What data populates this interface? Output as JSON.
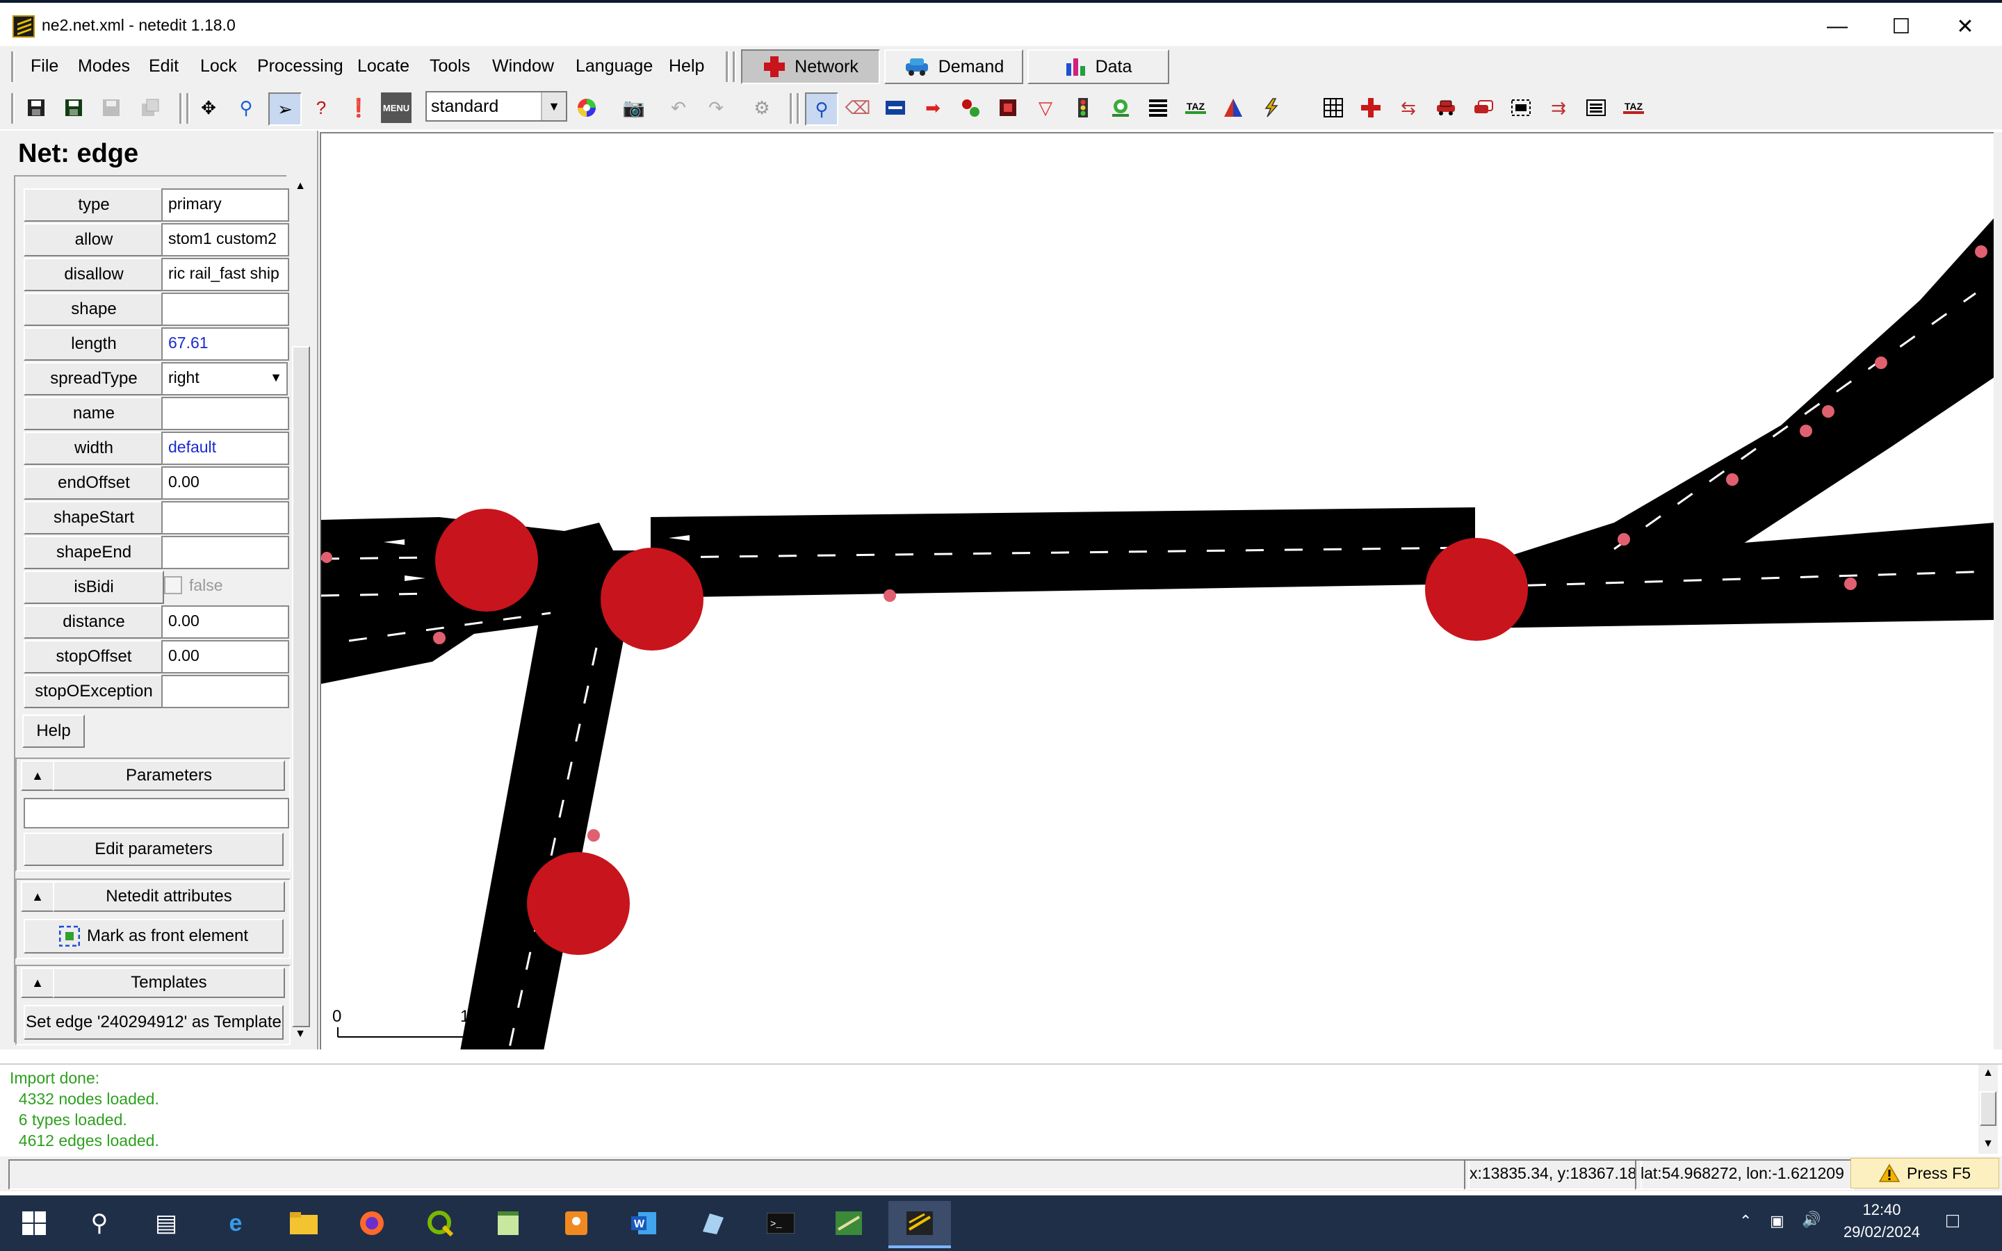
{
  "window": {
    "title": "ne2.net.xml - netedit 1.18.0"
  },
  "menu": {
    "items": [
      "File",
      "Modes",
      "Edit",
      "Lock",
      "Processing",
      "Locate",
      "Tools",
      "Window",
      "Language",
      "Help"
    ],
    "supermodes": [
      "Network",
      "Demand",
      "Data"
    ]
  },
  "toolbar": {
    "scheme": "standard",
    "taz_label_1": "TAZ",
    "taz_label_2": "TAZ",
    "menu_label": "MENU"
  },
  "sidebar": {
    "title": "Net: edge",
    "attributes": [
      {
        "name": "type",
        "value": "primary"
      },
      {
        "name": "allow",
        "value": "stom1 custom2"
      },
      {
        "name": "disallow",
        "value": "ric rail_fast ship"
      },
      {
        "name": "shape",
        "value": ""
      },
      {
        "name": "length",
        "value": "67.61"
      },
      {
        "name": "spreadType",
        "value": "right"
      },
      {
        "name": "name",
        "value": ""
      },
      {
        "name": "width",
        "value": "default"
      },
      {
        "name": "endOffset",
        "value": "0.00"
      },
      {
        "name": "shapeStart",
        "value": ""
      },
      {
        "name": "shapeEnd",
        "value": ""
      },
      {
        "name": "isBidi",
        "value": "false"
      },
      {
        "name": "distance",
        "value": "0.00"
      },
      {
        "name": "stopOffset",
        "value": "0.00"
      },
      {
        "name": "stopOException",
        "value": ""
      }
    ],
    "help_label": "Help",
    "parameters_header": "Parameters",
    "parameters_value": "",
    "edit_parameters_label": "Edit parameters",
    "netedit_attributes_header": "Netedit attributes",
    "mark_front_label": "Mark as front element",
    "templates_header": "Templates",
    "set_template_label": "Set edge '240294912' as Template"
  },
  "canvas": {
    "scale_start": "0",
    "scale_end": "1"
  },
  "messages": {
    "lines": [
      "Import done:",
      "  4332 nodes loaded.",
      "  6 types loaded.",
      "  4612 edges loaded."
    ]
  },
  "status": {
    "coords": "x:13835.34, y:18367.18",
    "geo": "lat:54.968272, lon:-1.621209",
    "hint": "Press F5"
  },
  "taskbar": {
    "time": "12:40",
    "date": "29/02/2024"
  },
  "colors": {
    "junction": "#c0201a",
    "road": "#000000",
    "message": "#2ea01f",
    "value_blue": "#1a2ad0"
  }
}
